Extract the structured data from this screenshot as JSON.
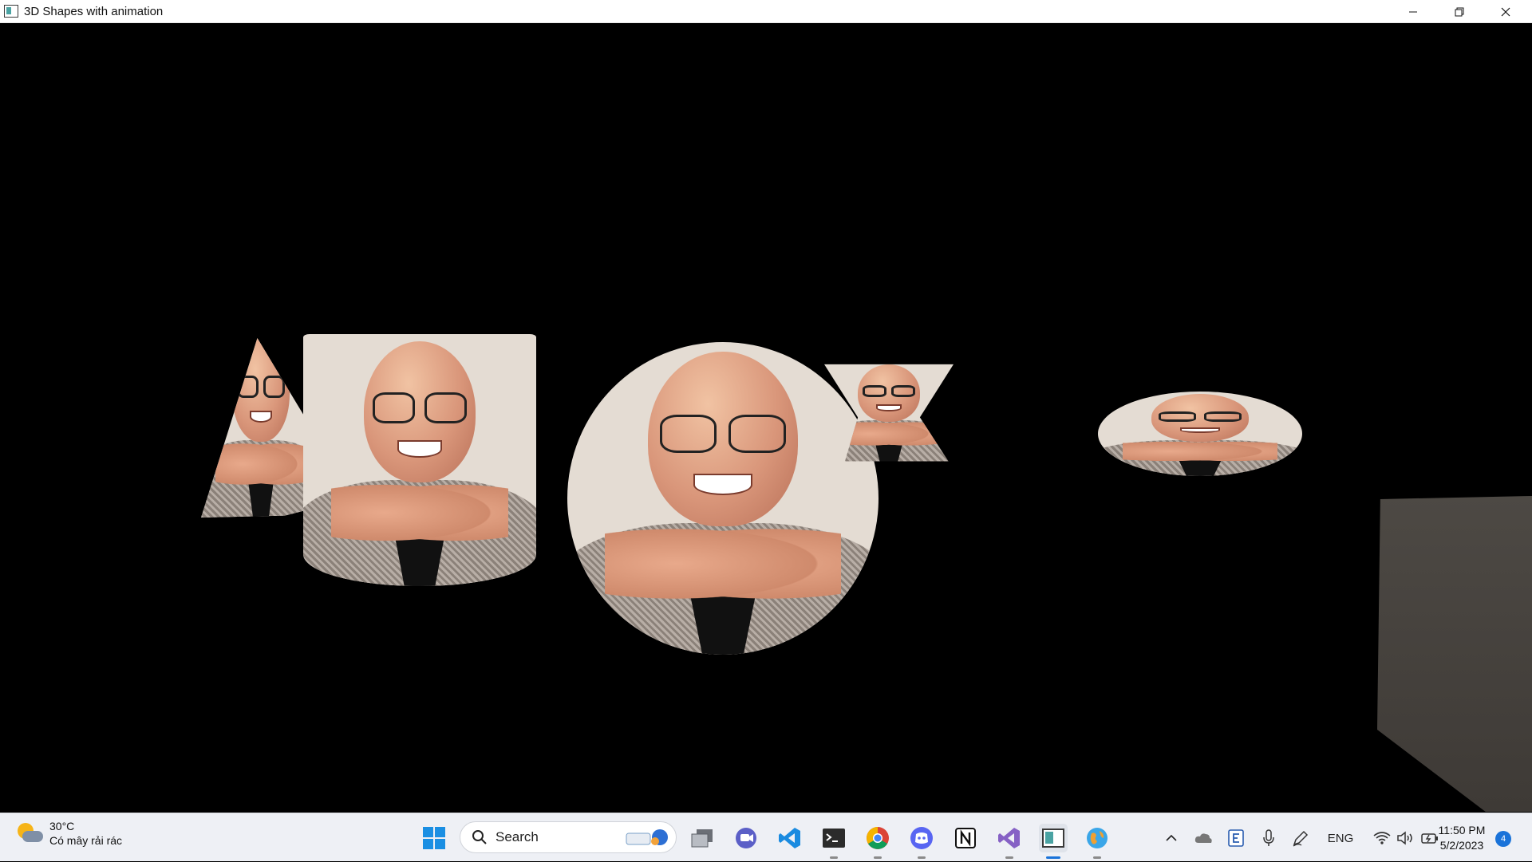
{
  "window": {
    "title": "3D Shapes with animation"
  },
  "scene": {
    "shapes": [
      "cone",
      "cylinder",
      "sphere",
      "hourglass",
      "torus",
      "cube"
    ],
    "background": "#000000"
  },
  "taskbar": {
    "weather": {
      "temp": "30°C",
      "condition": "Có mây rải rác"
    },
    "search_label": "Search",
    "pinned": [
      "windows-start",
      "search",
      "task-view",
      "teams-chat",
      "vscode",
      "terminal",
      "chrome",
      "discord",
      "notion",
      "visual-studio",
      "3d-shapes-app",
      "globe-app"
    ],
    "tray": {
      "language": "ENG"
    },
    "clock": {
      "time": "11:50 PM",
      "date": "5/2/2023"
    },
    "notifications": "4"
  },
  "colors": {
    "taskbar_bg": "#eef0f5",
    "accent": "#1a73d9",
    "scene_bg": "#000000"
  }
}
